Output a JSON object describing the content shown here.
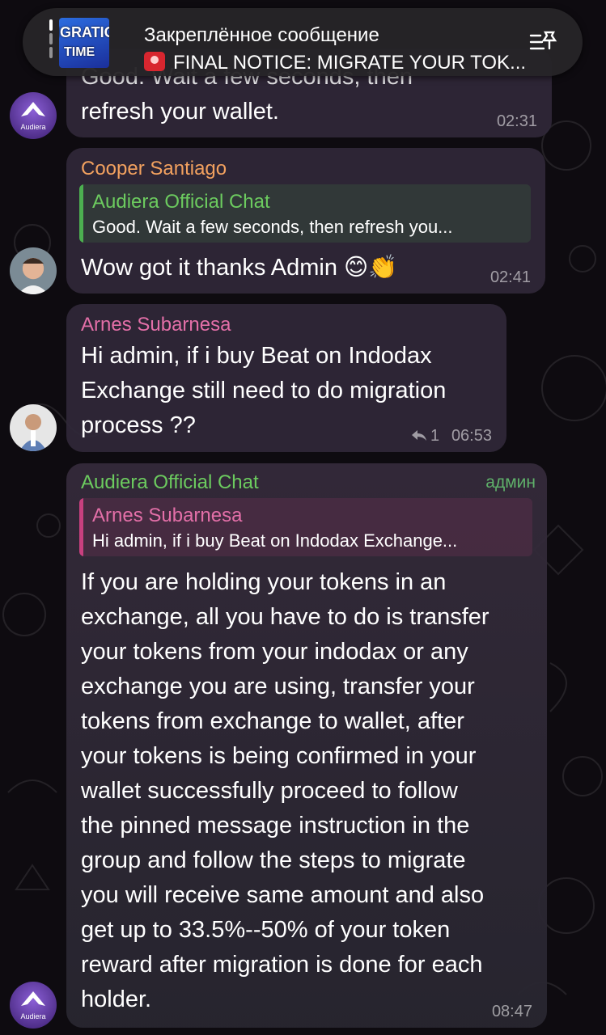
{
  "pinned": {
    "title": "Закреплённое сообщение",
    "message": "FINAL NOTICE: MIGRATE YOUR TOK...",
    "thumb_line1": "IGRATIO",
    "thumb_line2": "TIME"
  },
  "messages": [
    {
      "text_cut": "Good. Wait a few seconds, then",
      "text": "refresh your wallet.",
      "time": "02:31"
    },
    {
      "sender": "Cooper Santiago",
      "reply_name": "Audiera Official Chat",
      "reply_text": "Good. Wait a few seconds, then refresh you...",
      "text": "Wow got it thanks Admin 😊👏",
      "time": "02:41"
    },
    {
      "sender": "Arnes Subarnesa",
      "text": "Hi admin, if i buy Beat on Indodax\nExchange still need to do migration\nprocess ??",
      "reply_count": "1",
      "time": "06:53"
    },
    {
      "sender": "Audiera Official Chat",
      "badge": "админ",
      "reply_name": "Arnes Subarnesa",
      "reply_text": "Hi admin, if i buy Beat on Indodax Exchange...",
      "text": "If you are holding your tokens in an\nexchange, all you have to do is transfer\nyour tokens from your indodax or any\nexchange you are using, transfer your\ntokens from exchange to wallet, after\nyour tokens is being confirmed in your\nwallet successfully proceed to follow\nthe pinned message instruction in the\ngroup and follow the steps to migrate\nyou will receive same amount and also\nget up to 33.5%--50% of your token\nreward after migration is done for each\nholder.",
      "time": "08:47"
    }
  ],
  "avatar_logo_text": "Audiera",
  "colors": {
    "bubble": "#302838",
    "orange_name": "#f2a15f",
    "green_name": "#6ccb5f",
    "pink_name": "#e36fa8",
    "green_bar": "#4caf50",
    "pink_bar": "#c9407f"
  },
  "icons": [
    "siren-icon",
    "pinned-list-icon",
    "reply-arrow-icon",
    "avatar-audiera-icon"
  ]
}
